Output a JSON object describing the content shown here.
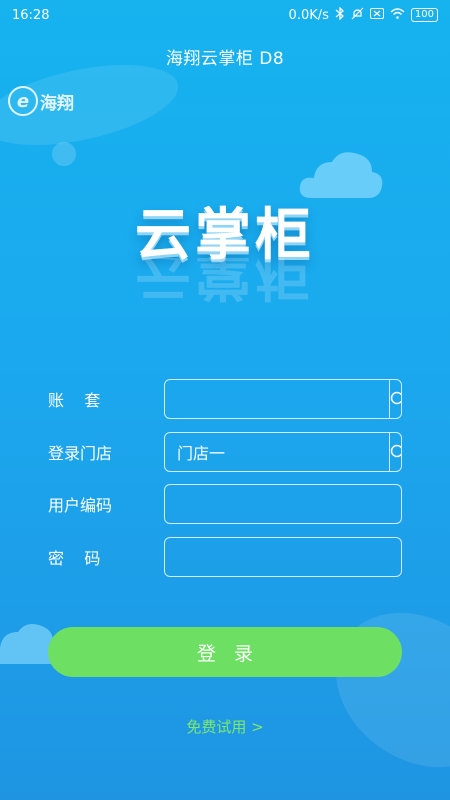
{
  "status": {
    "time": "16:28",
    "network_speed": "0.0K/s",
    "battery": "100"
  },
  "header": {
    "title": "海翔云掌柜 D8"
  },
  "logo": {
    "text": "海翔"
  },
  "hero": {
    "title": "云掌柜"
  },
  "form": {
    "account_label": "账    套",
    "account_value": "",
    "store_label": "登录门店",
    "store_value": "门店一",
    "user_code_label": "用户编码",
    "user_code_value": "",
    "password_label": "密    码",
    "password_value": ""
  },
  "actions": {
    "login_label": "登录",
    "free_trial_label": "免费试用 >"
  },
  "colors": {
    "background": "#1ba8ee",
    "login_button": "#6de063",
    "trial_link": "#7ee86d"
  }
}
